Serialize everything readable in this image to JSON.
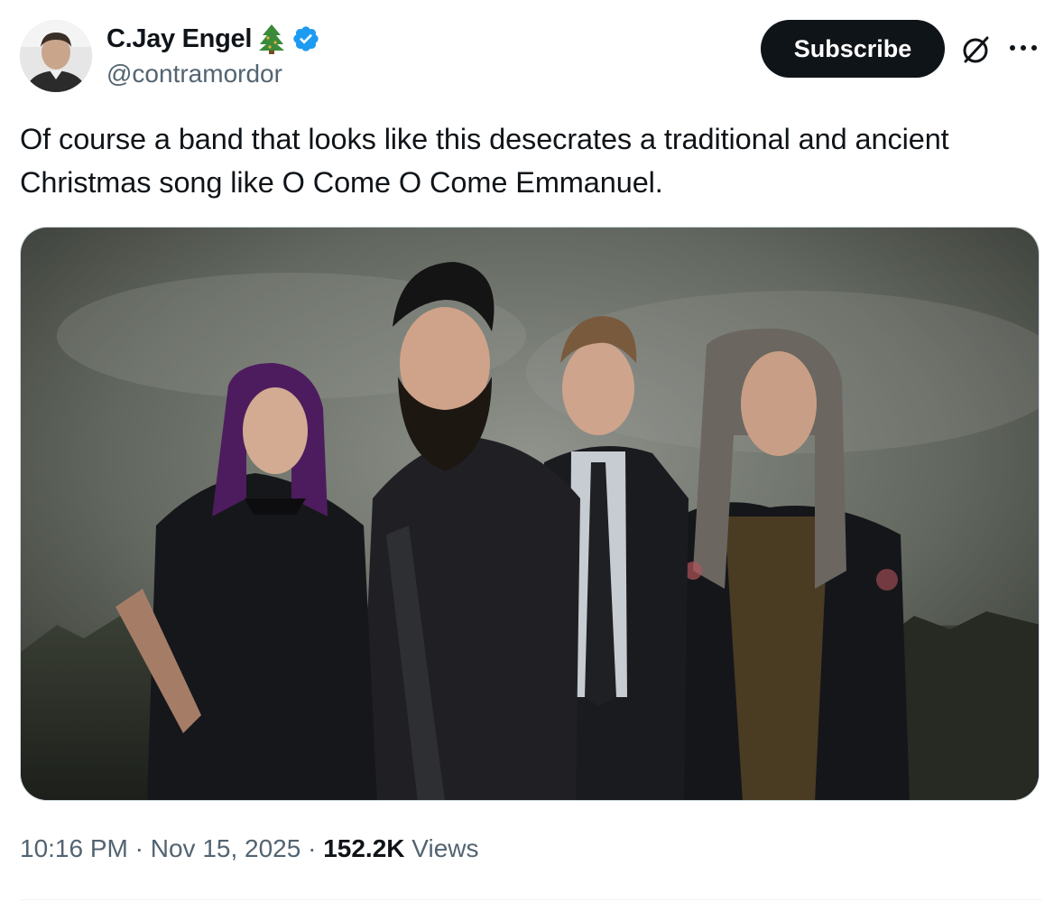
{
  "author": {
    "display_name": "C.Jay Engel",
    "handle": "@contramordor",
    "name_emoji": "christmas-tree-icon",
    "verified_badge": "verified-badge-icon",
    "verified_color": "#1d9bf0"
  },
  "actions": {
    "subscribe_label": "Subscribe",
    "grok_icon": "grok-icon",
    "more_icon": "more-icon"
  },
  "tweet": {
    "text": "Of course a band that looks like this desecrates a traditional and ancient Christmas song like O Come O Come Emmanuel."
  },
  "media": {
    "type": "photo",
    "subject": "four band members posed in black clothing against a grey sky"
  },
  "meta": {
    "time": "10:16 PM",
    "separator": "·",
    "date": "Nov 15, 2025",
    "views_count": "152.2K",
    "views_label": "Views"
  },
  "colors": {
    "text_primary": "#0f1419",
    "text_secondary": "#536471",
    "button_bg": "#0f1419",
    "border": "#cfd9de"
  }
}
